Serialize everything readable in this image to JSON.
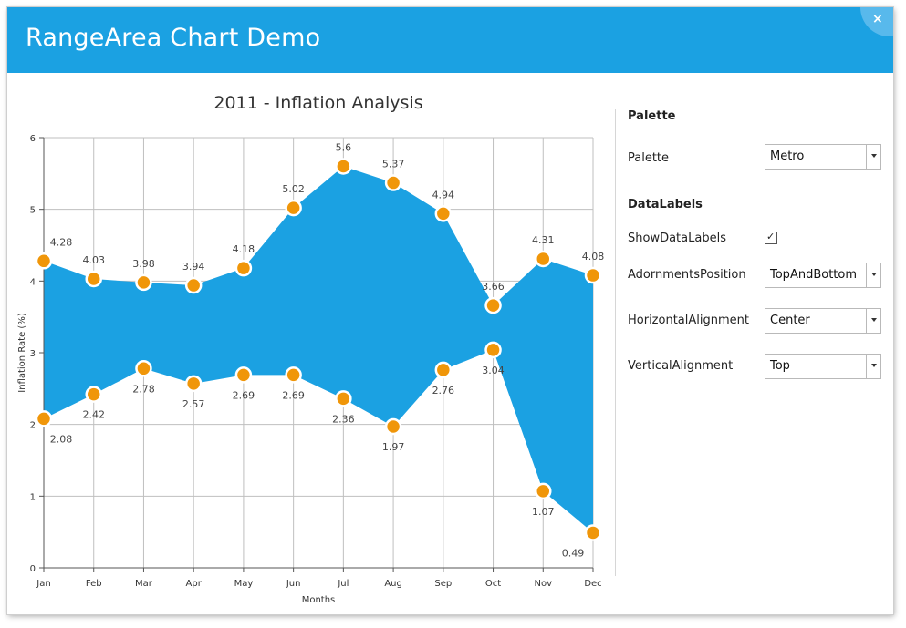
{
  "window": {
    "title": "RangeArea Chart Demo",
    "close_symbol": "×"
  },
  "colors": {
    "titlebar": "#1ba1e2",
    "area_fill": "#1ba1e2",
    "marker": "#f09609",
    "grid": "#bfbfbf"
  },
  "chart_data": {
    "type": "area",
    "subtype": "range-area",
    "title": "2011 - Inflation Analysis",
    "xlabel": "Months",
    "ylabel": "Inflation Rate (%)",
    "categories": [
      "Jan",
      "Feb",
      "Mar",
      "Apr",
      "May",
      "Jun",
      "Jul",
      "Aug",
      "Sep",
      "Oct",
      "Nov",
      "Dec"
    ],
    "high": [
      4.28,
      4.03,
      3.98,
      3.94,
      4.18,
      5.02,
      5.6,
      5.37,
      4.94,
      3.66,
      4.31,
      4.08
    ],
    "low": [
      2.08,
      2.42,
      2.78,
      2.57,
      2.69,
      2.69,
      2.36,
      1.97,
      2.76,
      3.04,
      1.07,
      0.49
    ],
    "high_labels": [
      "4.28",
      "4.03",
      "3.98",
      "3.94",
      "4.18",
      "5.02",
      "5.6",
      "5.37",
      "4.94",
      "3.66",
      "4.31",
      "4.08"
    ],
    "low_labels": [
      "2.08",
      "2.42",
      "2.78",
      "2.57",
      "2.69",
      "2.69",
      "2.36",
      "1.97",
      "2.76",
      "3.04",
      "1.07",
      "0.49"
    ],
    "ylim": [
      0,
      6
    ],
    "yticks": [
      "0",
      "1",
      "2",
      "3",
      "4",
      "5",
      "6"
    ],
    "grid": true,
    "legend": "none",
    "show_data_labels": true
  },
  "panel": {
    "palette_section": "Palette",
    "palette_label": "Palette",
    "palette_value": "Metro",
    "datalabels_section": "DataLabels",
    "show_datalabels_label": "ShowDataLabels",
    "show_datalabels_checked": true,
    "check_symbol": "✓",
    "adornments_label": "AdornmentsPosition",
    "adornments_value": "TopAndBottom",
    "horizontal_label": "HorizontalAlignment",
    "horizontal_value": "Center",
    "vertical_label": "VerticalAlignment",
    "vertical_value": "Top"
  }
}
